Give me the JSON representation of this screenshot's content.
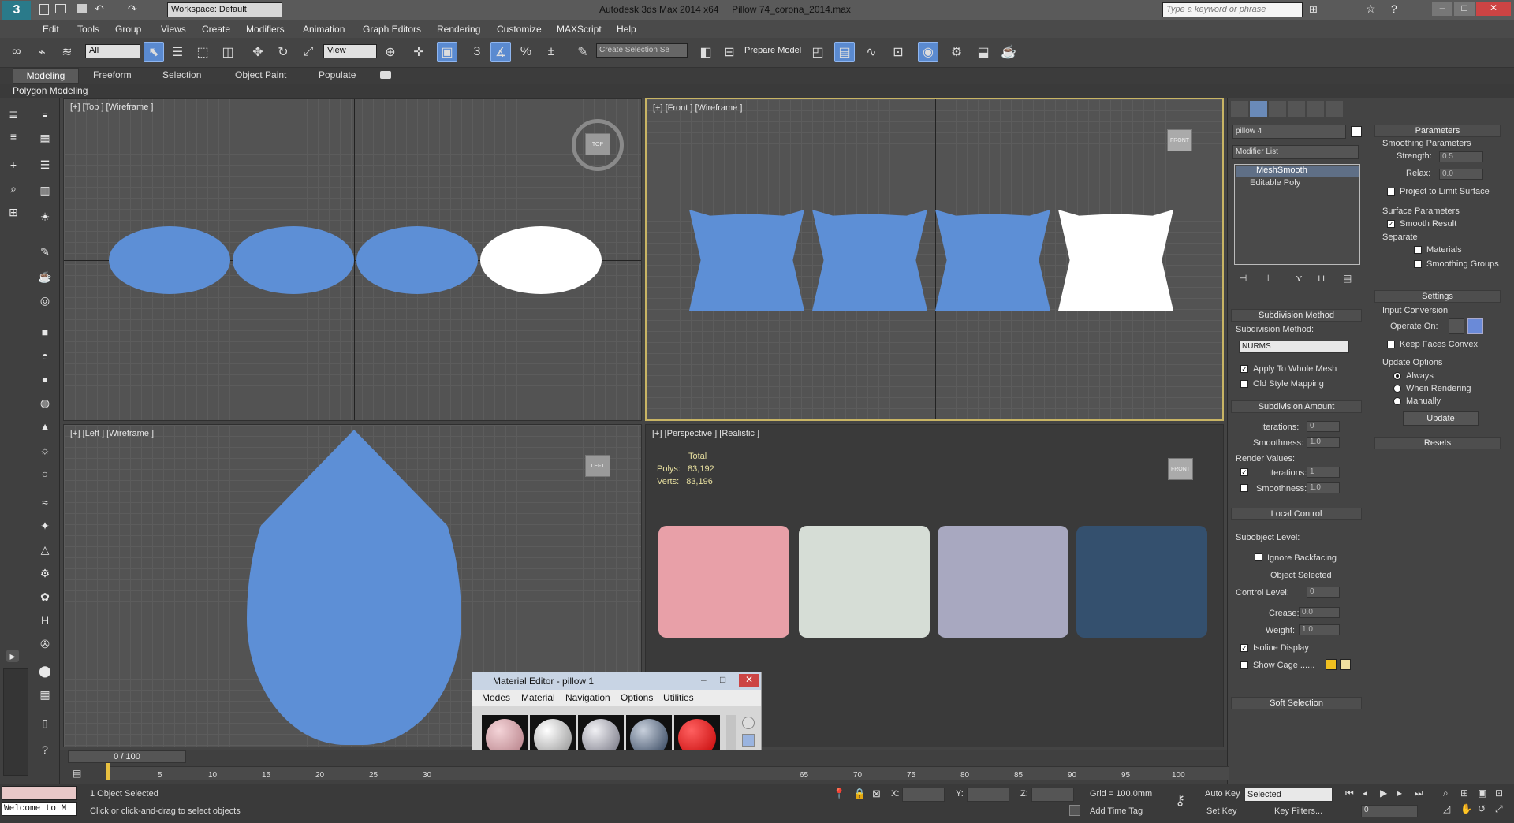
{
  "title": {
    "app": "Autodesk 3ds Max  2014 x64",
    "file": "Pillow 74_corona_2014.max",
    "workspace": "Workspace: Default",
    "search_placeholder": "Type a keyword or phrase"
  },
  "menu": [
    "Edit",
    "Tools",
    "Group",
    "Views",
    "Create",
    "Modifiers",
    "Animation",
    "Graph Editors",
    "Rendering",
    "Customize",
    "MAXScript",
    "Help"
  ],
  "toolbar": {
    "selection_filter": "All",
    "ref_coord": "View",
    "named_selection": "Create Selection Se",
    "prepare_model": "Prepare Model"
  },
  "ribbon": {
    "tabs": [
      "Modeling",
      "Freeform",
      "Selection",
      "Object Paint",
      "Populate"
    ],
    "sub": "Polygon Modeling"
  },
  "viewports": {
    "top": "[+] [Top ] [Wireframe ]",
    "front": "[+] [Front ] [Wireframe ]",
    "left": "[+] [Left ] [Wireframe ]",
    "persp": "[+] [Perspective ] [Realistic ]",
    "cube_top": "TOP",
    "cube_front": "FRONT",
    "cube_left": "LEFT"
  },
  "stats": {
    "header": "Total",
    "polys_label": "Polys:",
    "polys": "83,192",
    "verts_label": "Verts:",
    "verts": "83,196"
  },
  "modify": {
    "object_name": "pillow 4",
    "modifier_list": "Modifier List",
    "stack": [
      "MeshSmooth",
      "Editable Poly"
    ],
    "subdiv_method_title": "Subdivision Method",
    "subdiv_method_label": "Subdivision Method:",
    "subdiv_method_value": "NURMS",
    "apply_whole": "Apply To Whole Mesh",
    "old_style": "Old Style Mapping",
    "subdiv_amount_title": "Subdivision Amount",
    "iterations_label": "Iterations:",
    "iterations": "0",
    "smoothness_label": "Smoothness:",
    "smoothness": "1.0",
    "render_values": "Render Values:",
    "r_iterations_label": "Iterations:",
    "r_iterations": "1",
    "r_smoothness_label": "Smoothness:",
    "r_smoothness": "1.0",
    "local_control_title": "Local Control",
    "subobject_label": "Subobject Level:",
    "ignore_backfacing": "Ignore Backfacing",
    "object_selected": "Object Selected",
    "control_level_label": "Control Level:",
    "control_level": "0",
    "crease_label": "Crease:",
    "crease": "0.0",
    "weight_label": "Weight:",
    "weight": "1.0",
    "isoline": "Isoline Display",
    "show_cage": "Show Cage ......",
    "soft_selection": "Soft Selection"
  },
  "params": {
    "title": "Parameters",
    "smoothing_params": "Smoothing Parameters",
    "strength_label": "Strength:",
    "strength": "0.5",
    "relax_label": "Relax:",
    "relax": "0.0",
    "project_limit": "Project to Limit Surface",
    "surface_params": "Surface Parameters",
    "smooth_result": "Smooth Result",
    "separate": "Separate",
    "materials": "Materials",
    "smoothing_groups": "Smoothing Groups",
    "settings": "Settings",
    "input_conversion": "Input Conversion",
    "operate_on": "Operate On:",
    "keep_convex": "Keep Faces Convex",
    "update_options": "Update Options",
    "always": "Always",
    "when_rendering": "When Rendering",
    "manually": "Manually",
    "update": "Update",
    "resets": "Resets"
  },
  "material_editor": {
    "title": "Material Editor - pillow 1",
    "menus": [
      "Modes",
      "Material",
      "Navigation",
      "Options",
      "Utilities"
    ]
  },
  "timeline": {
    "frame": "0 / 100",
    "ticks": [
      "5",
      "10",
      "15",
      "20",
      "25",
      "30",
      "65",
      "70",
      "75",
      "80",
      "85",
      "90",
      "95",
      "100"
    ]
  },
  "status": {
    "welcome": "Welcome to M",
    "selected": "1 Object Selected",
    "hint": "Click or click-and-drag to select objects",
    "x": "X:",
    "y": "Y:",
    "z": "Z:",
    "grid": "Grid = 100.0mm",
    "add_time_tag": "Add Time Tag",
    "auto_key": "Auto Key",
    "set_key": "Set Key",
    "selected_dd": "Selected",
    "key_filters": "Key Filters...",
    "frame_field": "0"
  },
  "colors": {
    "pillow_blue": "#5d8fd6",
    "active_border": "#c8b464",
    "cage1": "#f0c020",
    "cage2": "#f0e0a0"
  }
}
